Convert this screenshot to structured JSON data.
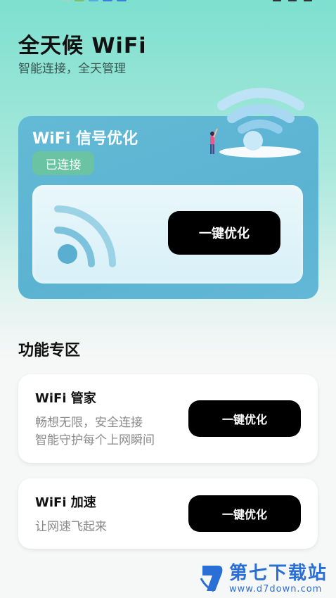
{
  "header": {
    "title": "全天候 WiFi",
    "subtitle": "智能连接，全天管理"
  },
  "signal_card": {
    "title": "WiFi 信号优化",
    "status_badge": "已连接",
    "optimize_button": "一键优化"
  },
  "features": {
    "section_title": "功能专区",
    "items": [
      {
        "title": "WiFi 管家",
        "desc_line1": "畅想无限，安全连接",
        "desc_line2": "智能守护每个上网瞬间",
        "button": "一键优化"
      },
      {
        "title": "WiFi 加速",
        "desc_line1": "让网速飞起来",
        "button": "一键优化"
      }
    ]
  },
  "watermark": {
    "name": "第七下载站",
    "url": "www.d7down.com"
  },
  "colors": {
    "card_blue": "#5bb3d2",
    "badge_green": "#6ac3a2",
    "button_black": "#000000",
    "watermark_blue": "#2a6fd6"
  },
  "icons": [
    "wifi-icon",
    "wifi-illustration",
    "person-illustration",
    "watermark-logo-icon"
  ]
}
